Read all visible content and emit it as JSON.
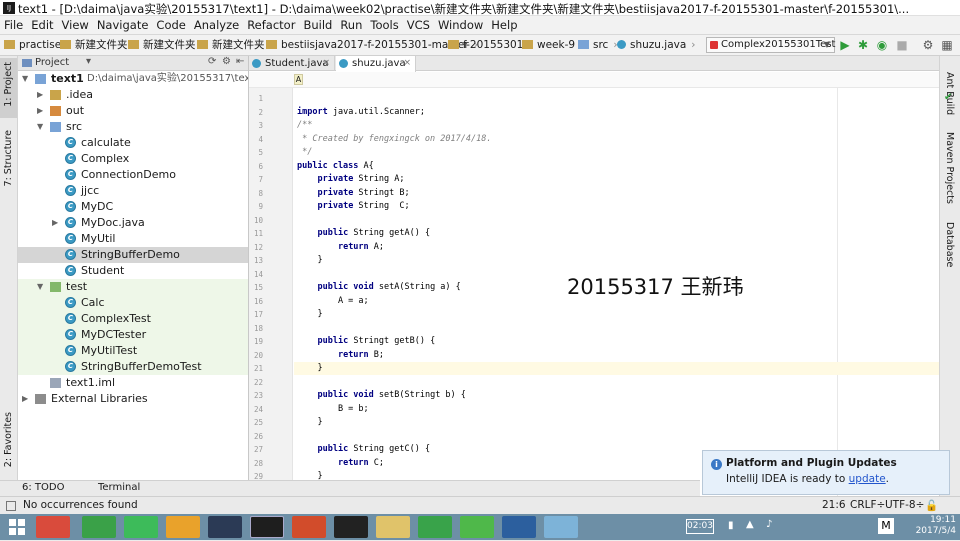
{
  "window": {
    "title": "text1 - [D:\\daima\\java实验\\20155317\\text1] - D:\\daima\\week02\\practise\\新建文件夹\\新建文件夹\\新建文件夹\\bestiisjava2017-f-20155301-master\\f-20155301\\..."
  },
  "menu": [
    "File",
    "Edit",
    "View",
    "Navigate",
    "Code",
    "Analyze",
    "Refactor",
    "Build",
    "Run",
    "Tools",
    "VCS",
    "Window",
    "Help"
  ],
  "breadcrumbs": [
    "practise",
    "新建文件夹",
    "新建文件夹",
    "新建文件夹",
    "bestiisjava2017-f-20155301-master",
    "f-20155301",
    "week-9",
    "src",
    "shuzu.java"
  ],
  "run_config": "Complex20155301Test",
  "left_strip": {
    "project": "1: Project",
    "structure": "7: Structure",
    "favorites": "2: Favorites"
  },
  "right_strip": {
    "ant": "Ant Build",
    "maven": "Maven Projects",
    "database": "Database"
  },
  "project_panel": {
    "title": "Project"
  },
  "tree": [
    {
      "label": "text1",
      "detail": "D:\\daima\\java实验\\20155317\\text1",
      "depth": 0,
      "icon": "module-icon",
      "arrow": "down"
    },
    {
      "label": ".idea",
      "depth": 1,
      "icon": "folder-icon",
      "arrow": "right"
    },
    {
      "label": "out",
      "depth": 1,
      "icon": "folder-orange-icon",
      "arrow": "right"
    },
    {
      "label": "src",
      "depth": 1,
      "icon": "folder-blue-icon",
      "arrow": "down"
    },
    {
      "label": "calculate",
      "depth": 2,
      "icon": "class-icon"
    },
    {
      "label": "Complex",
      "depth": 2,
      "icon": "class-icon"
    },
    {
      "label": "ConnectionDemo",
      "depth": 2,
      "icon": "class-icon"
    },
    {
      "label": "jjcc",
      "depth": 2,
      "icon": "class-icon"
    },
    {
      "label": "MyDC",
      "depth": 2,
      "icon": "class-icon"
    },
    {
      "label": "MyDoc.java",
      "depth": 2,
      "icon": "class-icon",
      "arrow": "right"
    },
    {
      "label": "MyUtil",
      "depth": 2,
      "icon": "class-icon"
    },
    {
      "label": "StringBufferDemo",
      "depth": 2,
      "icon": "class-icon",
      "selected": true
    },
    {
      "label": "Student",
      "depth": 2,
      "icon": "class-icon"
    },
    {
      "label": "test",
      "depth": 1,
      "icon": "folder-green-icon",
      "arrow": "down",
      "testgroup": true
    },
    {
      "label": "Calc",
      "depth": 2,
      "icon": "class-icon",
      "testgroup": true
    },
    {
      "label": "ComplexTest",
      "depth": 2,
      "icon": "class-icon",
      "testgroup": true
    },
    {
      "label": "MyDCTester",
      "depth": 2,
      "icon": "class-icon",
      "testgroup": true
    },
    {
      "label": "MyUtilTest",
      "depth": 2,
      "icon": "class-icon",
      "testgroup": true
    },
    {
      "label": "StringBufferDemoTest",
      "depth": 2,
      "icon": "class-icon",
      "testgroup": true
    },
    {
      "label": "text1.iml",
      "depth": 1,
      "icon": "iml-icon"
    },
    {
      "label": "External Libraries",
      "depth": 0,
      "icon": "library-icon",
      "arrow": "right"
    }
  ],
  "editor_tabs": [
    {
      "label": "Student.java",
      "active": false
    },
    {
      "label": "shuzu.java",
      "active": true
    }
  ],
  "editor_crumb": "A",
  "code_lines": [
    {
      "n": 1,
      "t": ""
    },
    {
      "n": 2,
      "t": "import java.util.Scanner;",
      "k": "import"
    },
    {
      "n": 3,
      "t": "/**",
      "c": true
    },
    {
      "n": 4,
      "t": " * Created by fengxingck on 2017/4/18.",
      "c": true
    },
    {
      "n": 5,
      "t": " */",
      "c": true
    },
    {
      "n": 6,
      "t": "public class A{",
      "k": "public class"
    },
    {
      "n": 7,
      "t": "    private String A;",
      "k": "private"
    },
    {
      "n": 8,
      "t": "    private Stringt B;",
      "k": "private"
    },
    {
      "n": 9,
      "t": "    private String  C;",
      "k": "private"
    },
    {
      "n": 10,
      "t": ""
    },
    {
      "n": 11,
      "t": "    public String getA() {",
      "k": "public"
    },
    {
      "n": 12,
      "t": "        return A;",
      "k": "return"
    },
    {
      "n": 13,
      "t": "    }"
    },
    {
      "n": 14,
      "t": ""
    },
    {
      "n": 15,
      "t": "    public void setA(String a) {",
      "k": "public void"
    },
    {
      "n": 16,
      "t": "        A = a;"
    },
    {
      "n": 17,
      "t": "    }"
    },
    {
      "n": 18,
      "t": ""
    },
    {
      "n": 19,
      "t": "    public Stringt getB() {",
      "k": "public"
    },
    {
      "n": 20,
      "t": "        return B;",
      "k": "return"
    },
    {
      "n": 21,
      "t": "    }",
      "current": true
    },
    {
      "n": 22,
      "t": ""
    },
    {
      "n": 23,
      "t": "    public void setB(Stringt b) {",
      "k": "public void"
    },
    {
      "n": 24,
      "t": "        B = b;"
    },
    {
      "n": 25,
      "t": "    }"
    },
    {
      "n": 26,
      "t": ""
    },
    {
      "n": 27,
      "t": "    public String getC() {",
      "k": "public"
    },
    {
      "n": 28,
      "t": "        return C;",
      "k": "return"
    },
    {
      "n": 29,
      "t": "    }"
    }
  ],
  "watermark": "20155317 王新玮",
  "notification": {
    "title": "Platform and Plugin Updates",
    "text": "IntelliJ IDEA is ready to ",
    "link": "update",
    "tail": "."
  },
  "bottom_tabs": {
    "todo": "6: TODO",
    "terminal": "Terminal"
  },
  "status": {
    "message": "No occurrences found",
    "position": "21:6",
    "line_sep": "CRLF÷",
    "encoding": "UTF-8÷"
  },
  "clock": {
    "time": "19:11",
    "date": "2017/5/4",
    "battery": "02:03"
  }
}
